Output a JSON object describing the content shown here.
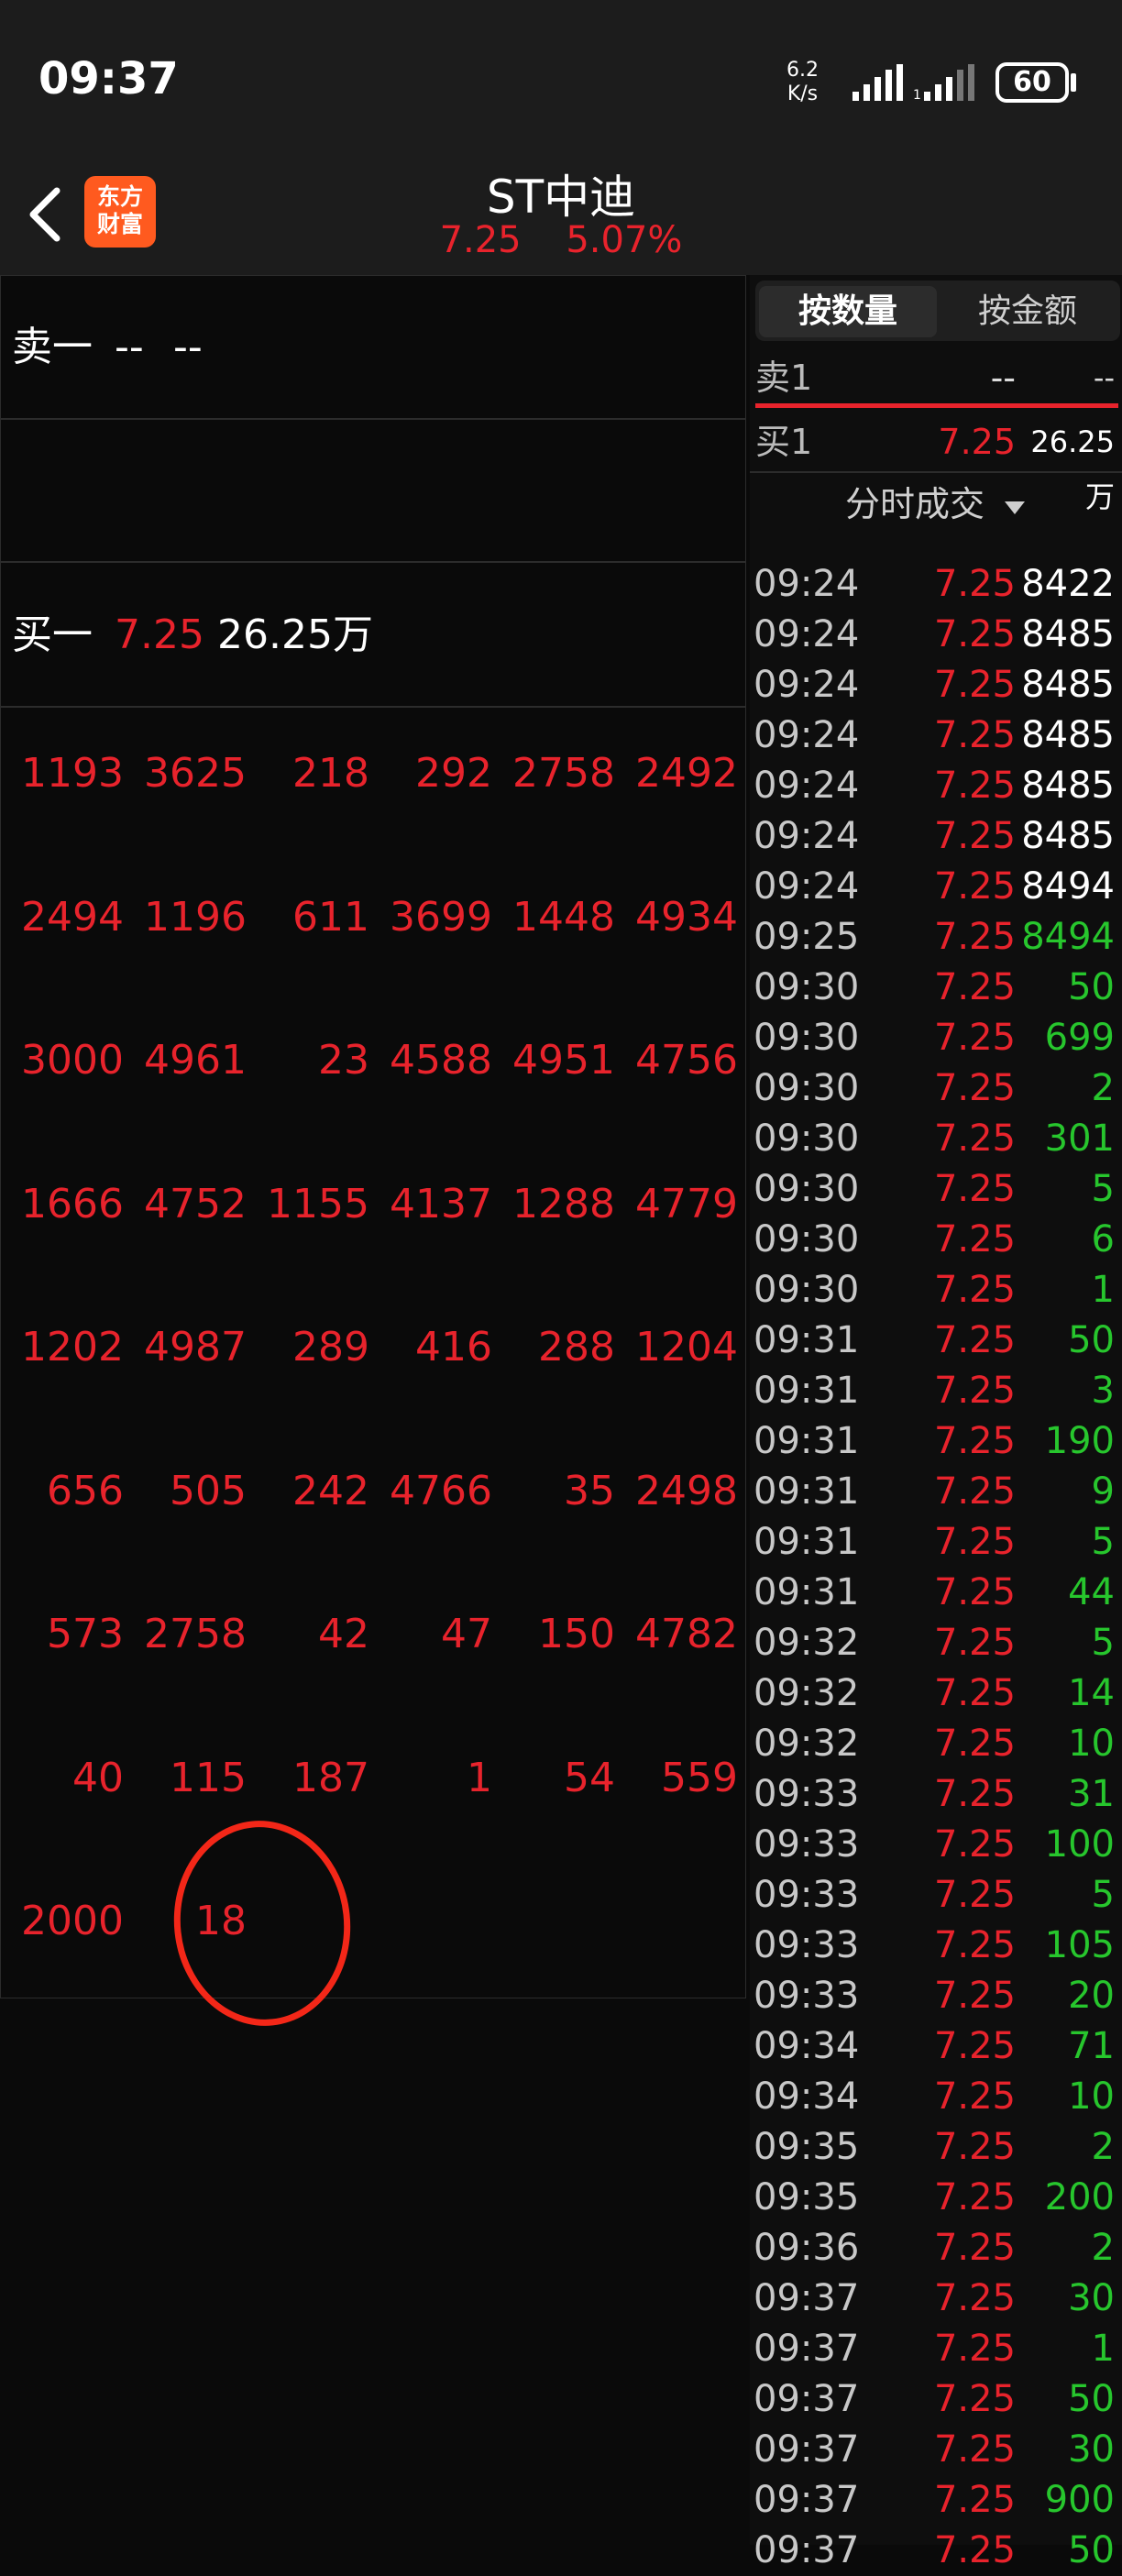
{
  "status": {
    "time": "09:37",
    "net_speed_value": "6.2",
    "net_speed_unit": "K/s",
    "battery": "60"
  },
  "header": {
    "title": "ST中迪",
    "price": "7.25",
    "change_pct": "5.07%",
    "logo_line1": "东方",
    "logo_line2": "财富"
  },
  "left": {
    "sell1": {
      "label": "卖一",
      "price": "--",
      "volume": "--"
    },
    "buy1": {
      "label": "买一",
      "price": "7.25",
      "volume": "26.25万"
    },
    "orders": [
      [
        "1193",
        "3625",
        "218",
        "292",
        "2758",
        "2492"
      ],
      [
        "2494",
        "1196",
        "611",
        "3699",
        "1448",
        "4934"
      ],
      [
        "3000",
        "4961",
        "23",
        "4588",
        "4951",
        "4756"
      ],
      [
        "1666",
        "4752",
        "1155",
        "4137",
        "1288",
        "4779"
      ],
      [
        "1202",
        "4987",
        "289",
        "416",
        "288",
        "1204"
      ],
      [
        "656",
        "505",
        "242",
        "4766",
        "35",
        "2498"
      ],
      [
        "573",
        "2758",
        "42",
        "47",
        "150",
        "4782"
      ],
      [
        "40",
        "115",
        "187",
        "1",
        "54",
        "559"
      ],
      [
        "2000",
        "18",
        "",
        "",
        "",
        ""
      ]
    ]
  },
  "right": {
    "tabs": [
      "按数量",
      "按金额"
    ],
    "sell1": {
      "label": "卖1",
      "price": "--",
      "volume": "--"
    },
    "buy1": {
      "label": "买1",
      "price": "7.25",
      "volume": "26.25万"
    },
    "fenshi_label": "分时成交",
    "ticks": [
      {
        "t": "09:24",
        "p": "7.25",
        "v": "8422",
        "c": "white"
      },
      {
        "t": "09:24",
        "p": "7.25",
        "v": "8485",
        "c": "white"
      },
      {
        "t": "09:24",
        "p": "7.25",
        "v": "8485",
        "c": "white"
      },
      {
        "t": "09:24",
        "p": "7.25",
        "v": "8485",
        "c": "white"
      },
      {
        "t": "09:24",
        "p": "7.25",
        "v": "8485",
        "c": "white"
      },
      {
        "t": "09:24",
        "p": "7.25",
        "v": "8485",
        "c": "white"
      },
      {
        "t": "09:24",
        "p": "7.25",
        "v": "8494",
        "c": "white"
      },
      {
        "t": "09:25",
        "p": "7.25",
        "v": "8494",
        "c": "green"
      },
      {
        "t": "09:30",
        "p": "7.25",
        "v": "50",
        "c": "green"
      },
      {
        "t": "09:30",
        "p": "7.25",
        "v": "699",
        "c": "green"
      },
      {
        "t": "09:30",
        "p": "7.25",
        "v": "2",
        "c": "green"
      },
      {
        "t": "09:30",
        "p": "7.25",
        "v": "301",
        "c": "green"
      },
      {
        "t": "09:30",
        "p": "7.25",
        "v": "5",
        "c": "green"
      },
      {
        "t": "09:30",
        "p": "7.25",
        "v": "6",
        "c": "green"
      },
      {
        "t": "09:30",
        "p": "7.25",
        "v": "1",
        "c": "green"
      },
      {
        "t": "09:31",
        "p": "7.25",
        "v": "50",
        "c": "green"
      },
      {
        "t": "09:31",
        "p": "7.25",
        "v": "3",
        "c": "green"
      },
      {
        "t": "09:31",
        "p": "7.25",
        "v": "190",
        "c": "green"
      },
      {
        "t": "09:31",
        "p": "7.25",
        "v": "9",
        "c": "green"
      },
      {
        "t": "09:31",
        "p": "7.25",
        "v": "5",
        "c": "green"
      },
      {
        "t": "09:31",
        "p": "7.25",
        "v": "44",
        "c": "green"
      },
      {
        "t": "09:32",
        "p": "7.25",
        "v": "5",
        "c": "green"
      },
      {
        "t": "09:32",
        "p": "7.25",
        "v": "14",
        "c": "green"
      },
      {
        "t": "09:32",
        "p": "7.25",
        "v": "10",
        "c": "green"
      },
      {
        "t": "09:33",
        "p": "7.25",
        "v": "31",
        "c": "green"
      },
      {
        "t": "09:33",
        "p": "7.25",
        "v": "100",
        "c": "green"
      },
      {
        "t": "09:33",
        "p": "7.25",
        "v": "5",
        "c": "green"
      },
      {
        "t": "09:33",
        "p": "7.25",
        "v": "105",
        "c": "green"
      },
      {
        "t": "09:33",
        "p": "7.25",
        "v": "20",
        "c": "green"
      },
      {
        "t": "09:34",
        "p": "7.25",
        "v": "71",
        "c": "green"
      },
      {
        "t": "09:34",
        "p": "7.25",
        "v": "10",
        "c": "green"
      },
      {
        "t": "09:35",
        "p": "7.25",
        "v": "2",
        "c": "green"
      },
      {
        "t": "09:35",
        "p": "7.25",
        "v": "200",
        "c": "green"
      },
      {
        "t": "09:36",
        "p": "7.25",
        "v": "2",
        "c": "green"
      },
      {
        "t": "09:37",
        "p": "7.25",
        "v": "30",
        "c": "green"
      },
      {
        "t": "09:37",
        "p": "7.25",
        "v": "1",
        "c": "green"
      },
      {
        "t": "09:37",
        "p": "7.25",
        "v": "50",
        "c": "green"
      },
      {
        "t": "09:37",
        "p": "7.25",
        "v": "30",
        "c": "green"
      },
      {
        "t": "09:37",
        "p": "7.25",
        "v": "900",
        "c": "green"
      },
      {
        "t": "09:37",
        "p": "7.25",
        "v": "50",
        "c": "green"
      }
    ]
  }
}
